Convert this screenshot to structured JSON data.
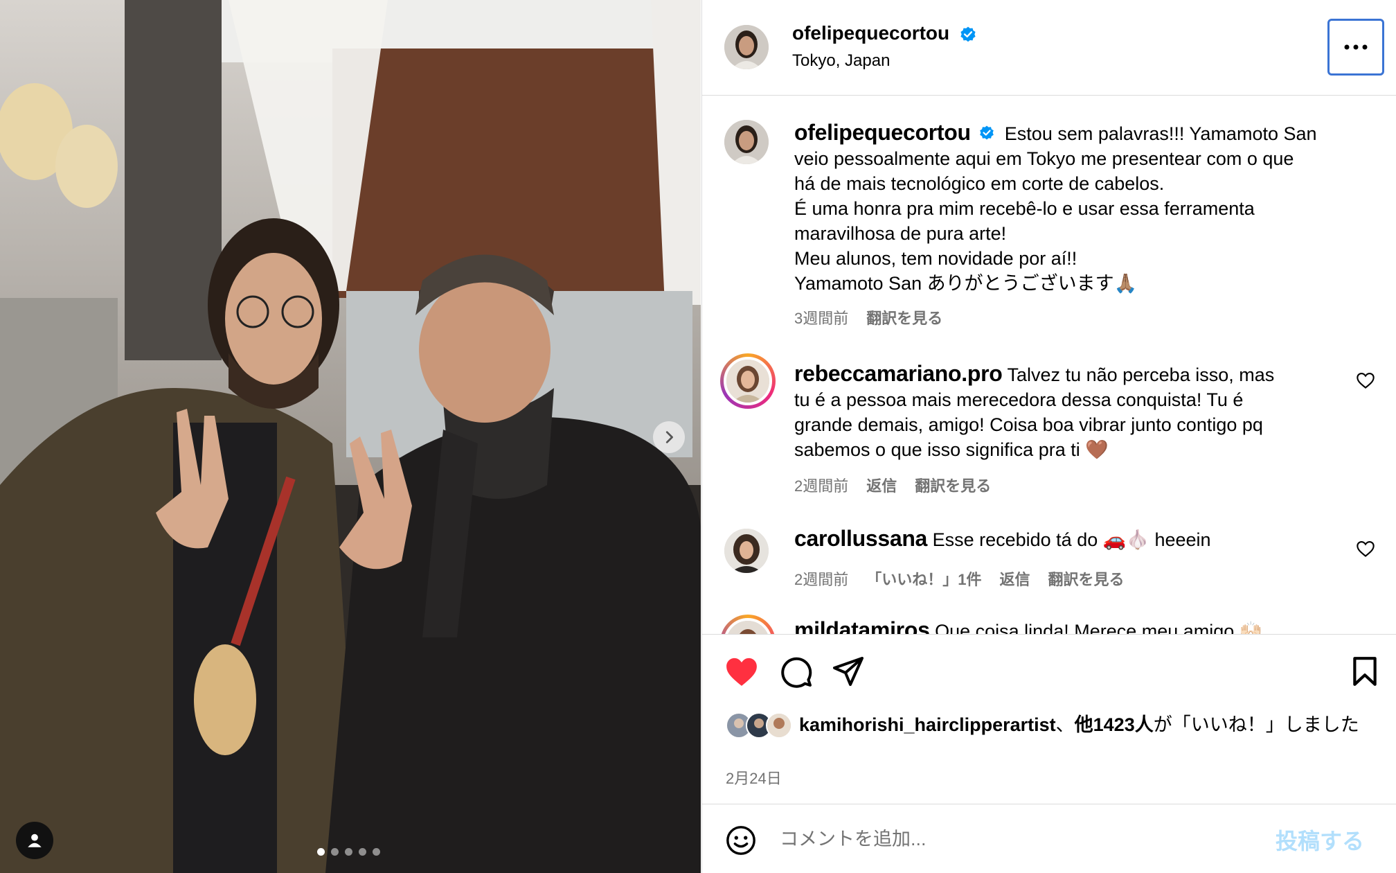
{
  "post": {
    "username": "ofelipequecortou",
    "location": "Tokyo, Japan",
    "more_icon": "more-horizontal-icon",
    "caption_lines": [
      "Estou sem palavras!!! Yamamoto San",
      "veio pessoalmente aqui em Tokyo me presentear com o que",
      "há de mais tecnológico em corte de cabelos.",
      "É uma honra pra mim recebê-lo e usar essa ferramenta",
      "maravilhosa de pura arte!",
      "Meu alunos, tem novidade por aí!!",
      "Yamamoto San ありがとうございます🙏🏽"
    ],
    "caption_time": "3週間前",
    "translate_label": "翻訳を見る"
  },
  "comments": [
    {
      "username": "rebeccamariano.pro",
      "lines": [
        "Talvez tu não perceba isso, mas",
        "tu é a pessoa mais merecedora dessa conquista! Tu é",
        "grande demais, amigo! Coisa boa vibrar junto contigo pq",
        "sabemos o que isso significa pra ti 🤎"
      ],
      "time": "2週間前",
      "reply_label": "返信",
      "translate_label": "翻訳を見る"
    },
    {
      "username": "carollussana",
      "lines": [
        "Esse recebido tá do 🚗🧄 heeein"
      ],
      "time": "2週間前",
      "likes_label": "「いいね！」1件",
      "reply_label": "返信",
      "translate_label": "翻訳を見る"
    },
    {
      "username": "mildatamiros",
      "lines": [
        "Que coisa linda! Merece meu amigo 🙌🏻"
      ]
    }
  ],
  "actions": {
    "liked": true,
    "like_icon": "heart-filled-icon",
    "comment_icon": "comment-icon",
    "share_icon": "send-icon",
    "save_icon": "bookmark-icon",
    "liked_by_user": "kamihorishi_hairclipperartist",
    "liked_by_sep": "、",
    "liked_by_others": "他1423人",
    "liked_by_suffix": "が「いいね！」しました",
    "date": "2月24日"
  },
  "compose": {
    "placeholder": "コメントを追加...",
    "post_label": "投稿する",
    "emoji_icon": "emoji-icon"
  },
  "carousel": {
    "slides": 5,
    "current": 1,
    "next_icon": "chevron-right-icon",
    "tag_icon": "user-tag-icon"
  },
  "colors": {
    "like_red": "#ff3040",
    "verified_blue": "#0095f6",
    "secondary_text": "#737373",
    "post_button_disabled": "#b2dffc"
  }
}
